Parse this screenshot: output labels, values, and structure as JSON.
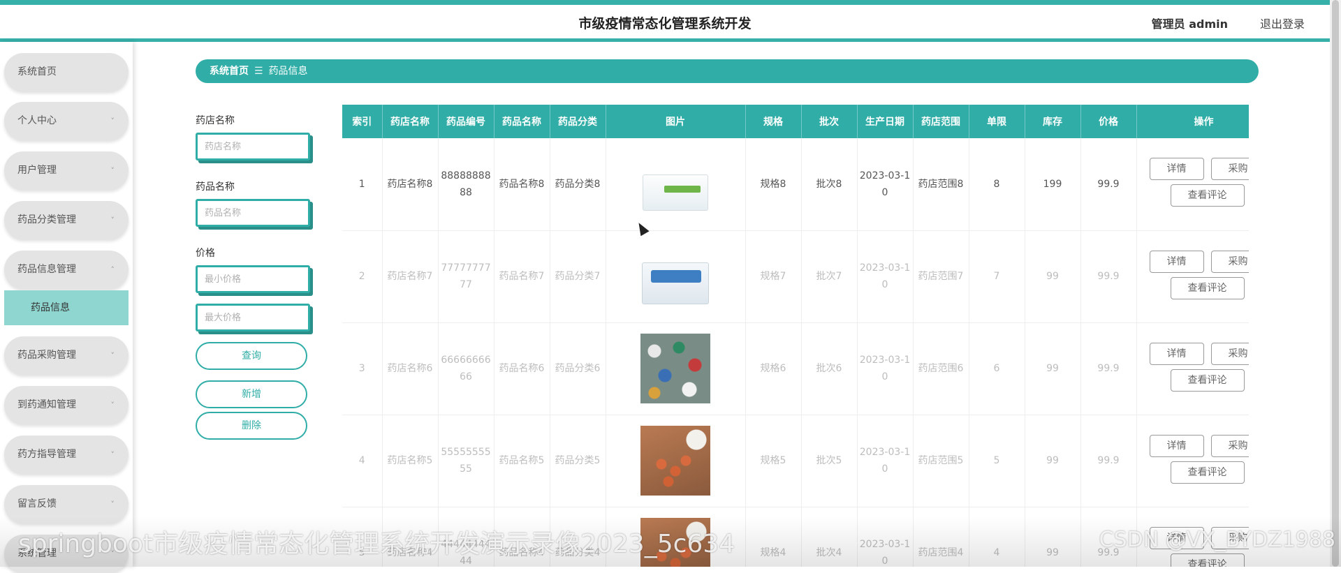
{
  "header": {
    "title": "市级疫情常态化管理系统开发",
    "user": "管理员 admin",
    "logout": "退出登录"
  },
  "sidebar": {
    "items": [
      {
        "label": "系统首页",
        "chevron": ""
      },
      {
        "label": "个人中心",
        "chevron": "˅"
      },
      {
        "label": "用户管理",
        "chevron": "˅"
      },
      {
        "label": "药品分类管理",
        "chevron": "˅"
      },
      {
        "label": "药品信息管理",
        "chevron": "˄"
      },
      {
        "label": "药品采购管理",
        "chevron": "˅"
      },
      {
        "label": "到药通知管理",
        "chevron": "˅"
      },
      {
        "label": "药方指导管理",
        "chevron": "˅"
      },
      {
        "label": "留言反馈",
        "chevron": "˅"
      },
      {
        "label": "系统管理",
        "chevron": "˅"
      }
    ],
    "subitem": "药品信息"
  },
  "breadcrumb": {
    "home": "系统首页",
    "separator": "☰",
    "current": "药品信息"
  },
  "search": {
    "store_label": "药店名称",
    "store_placeholder": "药店名称",
    "drug_label": "药品名称",
    "drug_placeholder": "药品名称",
    "price_label": "价格",
    "min_placeholder": "最小价格",
    "max_placeholder": "最大价格",
    "query": "查询",
    "add": "新增",
    "delete": "删除"
  },
  "table": {
    "headers": [
      "索引",
      "药店名称",
      "药品编号",
      "药品名称",
      "药品分类",
      "图片",
      "规格",
      "批次",
      "生产日期",
      "药店范围",
      "单限",
      "库存",
      "价格",
      "操作"
    ],
    "rows": [
      {
        "index": "1",
        "store": "药店名称8",
        "code": "8888888888",
        "name": "药品名称8",
        "category": "药品分类8",
        "image": "medicine-box-image",
        "spec": "规格8",
        "batch": "批次8",
        "date": "2023-03-10",
        "range": "药店范围8",
        "limit": "8",
        "stock": "199",
        "price": "99.9"
      },
      {
        "index": "2",
        "store": "药店名称7",
        "code": "7777777777",
        "name": "药品名称7",
        "category": "药品分类7",
        "image": "medicine-box-image",
        "spec": "规格7",
        "batch": "批次7",
        "date": "2023-03-10",
        "range": "药店范围7",
        "limit": "7",
        "stock": "99",
        "price": "99.9"
      },
      {
        "index": "3",
        "store": "药店名称6",
        "code": "6666666666",
        "name": "药品名称6",
        "category": "药品分类6",
        "image": "pills-photo",
        "spec": "规格6",
        "batch": "批次6",
        "date": "2023-03-10",
        "range": "药店范围6",
        "limit": "6",
        "stock": "99",
        "price": "99.9"
      },
      {
        "index": "4",
        "store": "药店名称5",
        "code": "5555555555",
        "name": "药品名称5",
        "category": "药品分类5",
        "image": "tablets-photo",
        "spec": "规格5",
        "batch": "批次5",
        "date": "2023-03-10",
        "range": "药店范围5",
        "limit": "5",
        "stock": "99",
        "price": "99.9"
      },
      {
        "index": "5",
        "store": "药店名称4",
        "code": "4444444444",
        "name": "药品名称4",
        "category": "药品分类4",
        "image": "tablets-photo",
        "spec": "规格4",
        "batch": "批次4",
        "date": "2023-03-10",
        "range": "药店范围4",
        "limit": "4",
        "stock": "99",
        "price": "99.9"
      }
    ],
    "ops": {
      "detail": "详情",
      "buy": "采购",
      "review": "查看评论"
    }
  },
  "watermark": {
    "left": "springboot市级疫情常态化管理系统开发演示录像2023_5c634",
    "right": "CSDN @VX_BYDZ1988"
  },
  "colors": {
    "accent": "#2fada6",
    "menu_bg": "#e4e4e4",
    "submenu_active": "#8fd6d0"
  }
}
